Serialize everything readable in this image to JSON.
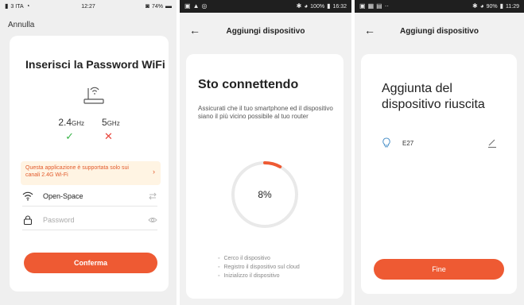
{
  "colors": {
    "accent": "#ee5a33",
    "success": "#3bb54a",
    "error": "#e8453c",
    "notice_bg": "#fff4e3"
  },
  "phone1": {
    "status": {
      "left": "3 ITA",
      "time": "12:27",
      "battery": "74%"
    },
    "cancel_label": "Annulla",
    "title": "Inserisci la Password WiFi",
    "router_icon": "router-wifi-icon",
    "bands": [
      {
        "value": "2.4",
        "unit": "GHz",
        "supported": true
      },
      {
        "value": "5",
        "unit": "GHz",
        "supported": false
      }
    ],
    "notice": "Questa applicazione è supportata solo sui canali 2.4G Wi-Fi",
    "ssid": "Open-Space",
    "password_placeholder": "Password",
    "confirm_label": "Conferma"
  },
  "phone2": {
    "status": {
      "right": "100%",
      "time": "16:32"
    },
    "header_title": "Aggiungi dispositivo",
    "title": "Sto connettendo",
    "description": "Assicurati che il tuo smartphone ed il dispositivo siano il più vicino possibile al tuo router",
    "progress": 8,
    "progress_label": "8%",
    "steps": [
      "Cerco il dispositivo",
      "Registro il dispositivo sul cloud",
      "Inizializzo il dispositivo"
    ]
  },
  "phone3": {
    "status": {
      "right": "90%",
      "time": "11:29"
    },
    "header_title": "Aggiungi dispositivo",
    "title": "Aggiunta del dispositivo riuscita",
    "device_name": "E27",
    "done_label": "Fine"
  }
}
